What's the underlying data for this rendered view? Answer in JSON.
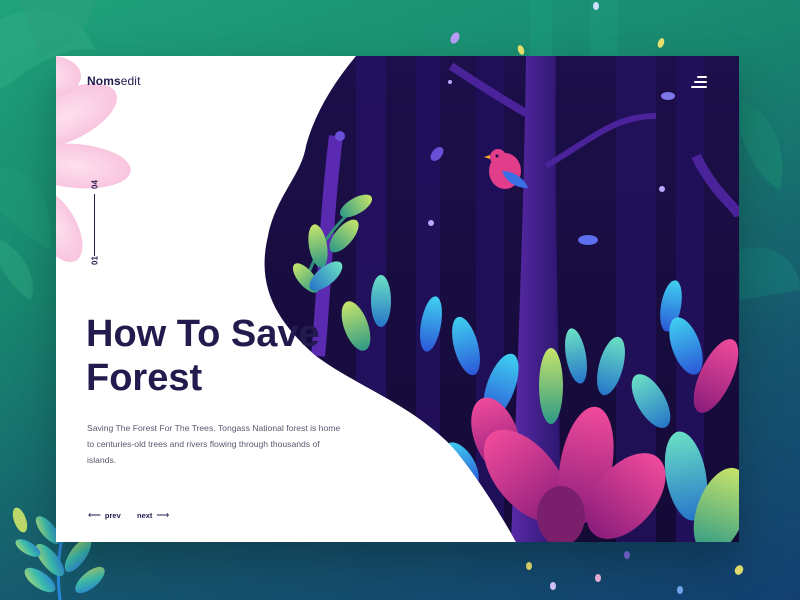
{
  "brand": {
    "bold": "Noms",
    "rest": "edit"
  },
  "menu": {
    "icon": "menu-icon"
  },
  "pager": {
    "current": "01",
    "total": "04"
  },
  "hero": {
    "title_line1": "How To Save",
    "title_line2": "Forest",
    "description": "Saving The Forest For The Trees. Tongass National forest is home to centuries-old trees and rivers flowing through thousands of islands."
  },
  "nav": {
    "prev_label": "prev",
    "next_label": "next",
    "prev_arrow": "⟵",
    "next_arrow": "⟶"
  },
  "colors": {
    "accent": "#231a4d",
    "forest_night": "#1a0f45",
    "leaf_pink": "#e63b8d",
    "leaf_blue": "#3c7ce6",
    "leaf_green": "#5fc39a"
  }
}
